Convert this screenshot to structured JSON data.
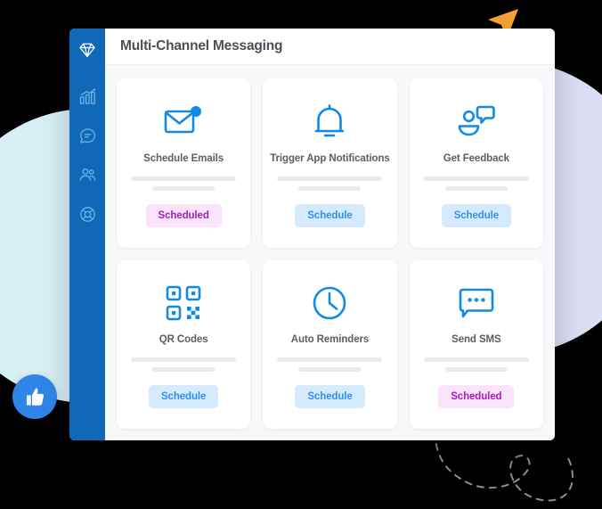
{
  "window": {
    "title": "Multi-Channel Messaging"
  },
  "sidebar": {
    "items": [
      {
        "name": "logo-diamond-icon",
        "label": "Brand"
      },
      {
        "name": "analytics-icon",
        "label": "Analytics"
      },
      {
        "name": "chat-icon",
        "label": "Messages"
      },
      {
        "name": "people-icon",
        "label": "Contacts"
      },
      {
        "name": "support-icon",
        "label": "Support"
      }
    ]
  },
  "colors": {
    "sidebar": "#0f68b8",
    "accent_blue": "#2f91f5",
    "badge_scheduled_bg": "#fae3fb",
    "badge_scheduled_text": "#a41fb8",
    "badge_schedule_bg": "#d5eafd",
    "badge_schedule_text": "#2f91f5",
    "cursor_arrow": "#f9a333",
    "blob_left": "#d7f0f4",
    "blob_right": "#dcdef4",
    "window_bg": "#f7f8fa"
  },
  "cards": [
    {
      "icon": "envelope-notification-icon",
      "title": "Schedule Emails",
      "action": "Scheduled",
      "state": "scheduled"
    },
    {
      "icon": "bell-icon",
      "title": "Trigger App Notifications",
      "action": "Schedule",
      "state": "schedule"
    },
    {
      "icon": "feedback-person-icon",
      "title": "Get Feedback",
      "action": "Schedule",
      "state": "schedule"
    },
    {
      "icon": "qr-code-icon",
      "title": "QR Codes",
      "action": "Schedule",
      "state": "schedule"
    },
    {
      "icon": "clock-icon",
      "title": "Auto Reminders",
      "action": "Schedule",
      "state": "schedule"
    },
    {
      "icon": "sms-bubble-icon",
      "title": "Send SMS",
      "action": "Scheduled",
      "state": "scheduled"
    }
  ],
  "decorations": {
    "cursor": "orange-pointer-arrow",
    "floating_badge": "thumbs-up-icon",
    "dashed_path": "dashed-curve-loop"
  }
}
